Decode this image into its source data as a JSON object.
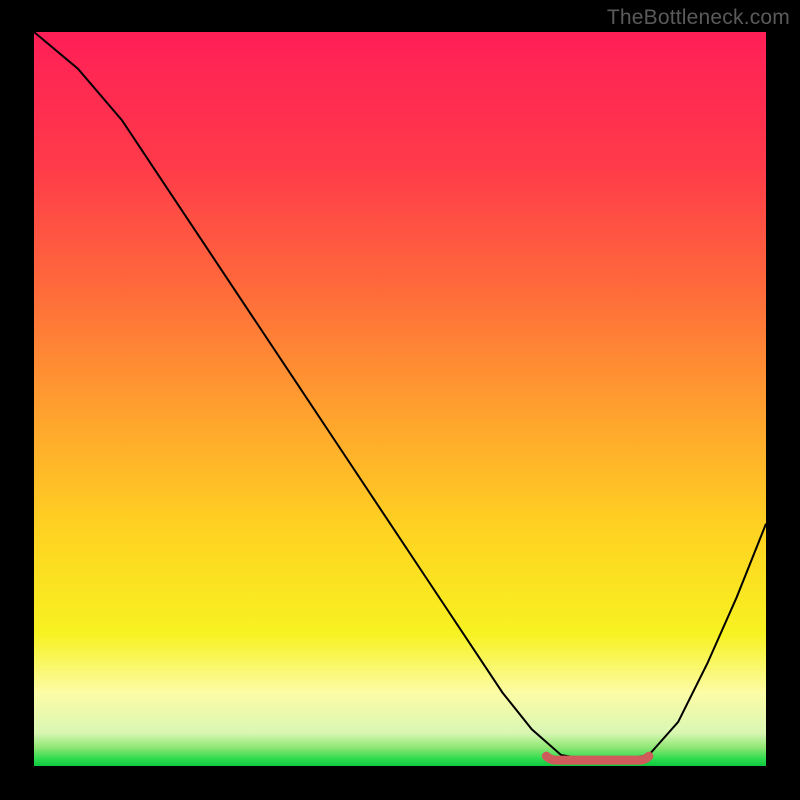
{
  "watermark": "TheBottleneck.com",
  "chart_data": {
    "type": "line",
    "title": "",
    "xlabel": "",
    "ylabel": "",
    "xlim": [
      0,
      100
    ],
    "ylim": [
      0,
      100
    ],
    "grid": false,
    "series": [
      {
        "name": "bottleneck-curve",
        "x": [
          0,
          6,
          12,
          18,
          24,
          30,
          36,
          42,
          48,
          54,
          60,
          64,
          68,
          72,
          76,
          80,
          84,
          88,
          92,
          96,
          100
        ],
        "values": [
          100,
          95,
          88,
          79,
          70,
          61,
          52,
          43,
          34,
          25,
          16,
          10,
          5,
          1.5,
          0.8,
          0.8,
          1.5,
          6,
          14,
          23,
          33
        ]
      }
    ],
    "marker_band": {
      "name": "optimum-range",
      "x_start": 70,
      "x_end": 84,
      "y": 0.8
    },
    "gradient_stops": [
      {
        "offset": 0.0,
        "color": "#ff1f57"
      },
      {
        "offset": 0.18,
        "color": "#ff3a4a"
      },
      {
        "offset": 0.35,
        "color": "#ff6a3b"
      },
      {
        "offset": 0.52,
        "color": "#ffa22e"
      },
      {
        "offset": 0.68,
        "color": "#ffd321"
      },
      {
        "offset": 0.82,
        "color": "#f7f221"
      },
      {
        "offset": 0.9,
        "color": "#fcfca6"
      },
      {
        "offset": 0.955,
        "color": "#d9f7b3"
      },
      {
        "offset": 0.975,
        "color": "#8ee673"
      },
      {
        "offset": 0.99,
        "color": "#2fdc4f"
      },
      {
        "offset": 1.0,
        "color": "#0ec93f"
      }
    ],
    "line_color": "#000000",
    "marker_color": "#cf5b5b"
  }
}
